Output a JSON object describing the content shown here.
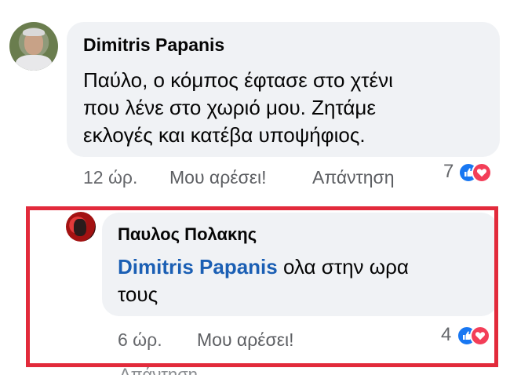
{
  "comments": [
    {
      "author": "Dimitris Papanis",
      "text_lines": [
        "Παύλο,  ο κόμπος έφτασε στο χτένι",
        "που λένε στο χωριό μου. Ζητάμε",
        "εκλογές και κατέβα υποψήφιος."
      ],
      "time": "12 ώρ.",
      "like_label": "Μου αρέσει!",
      "reply_label": "Απάντηση",
      "reaction_count": "7",
      "reactions": [
        "like-icon",
        "love-icon"
      ]
    },
    {
      "author": "Παυλος Πολακης",
      "mention": "Dimitris Papanis",
      "text_line1_rest": " ολα στην ωρα",
      "text_line2": "τους",
      "time": "6 ώρ.",
      "like_label": "Μου αρέσει!",
      "reply_label": "Απάντηση",
      "reaction_count": "4",
      "reactions": [
        "like-icon",
        "love-icon"
      ]
    }
  ],
  "colors": {
    "bubble": "#f0f2f5",
    "mention": "#1b5fb4",
    "highlight_border": "#e22a3b",
    "like": "#1877f2",
    "love": "#f33e58"
  }
}
